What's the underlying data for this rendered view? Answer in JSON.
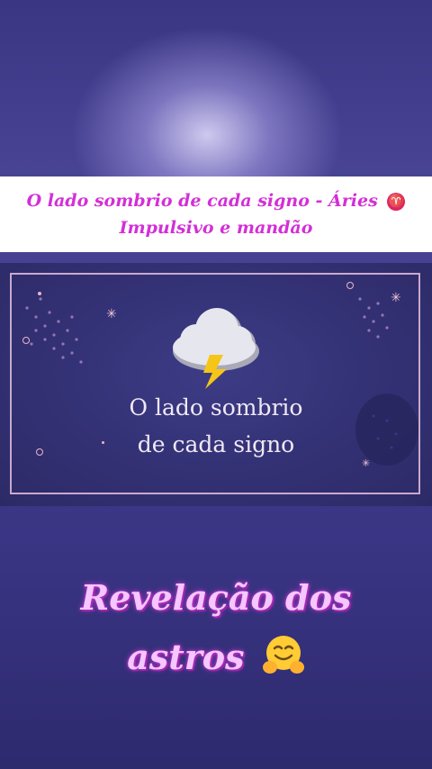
{
  "banner": {
    "line1": "O lado sombrio de cada signo - Áries",
    "zodiac_glyph": "♈",
    "line2": "Impulsivo e mandão"
  },
  "card": {
    "title_line1": "O lado sombrio",
    "title_line2": "de cada signo",
    "icon": "storm-cloud-lightning-icon"
  },
  "caption": {
    "line1": "Revelação dos",
    "line2": "astros",
    "emoji": "hugging-face-icon"
  },
  "colors": {
    "banner_text": "#d32fd6",
    "caption_glow": "#c63bd6",
    "card_border": "#c9a9cf",
    "background": "#3a3683"
  }
}
